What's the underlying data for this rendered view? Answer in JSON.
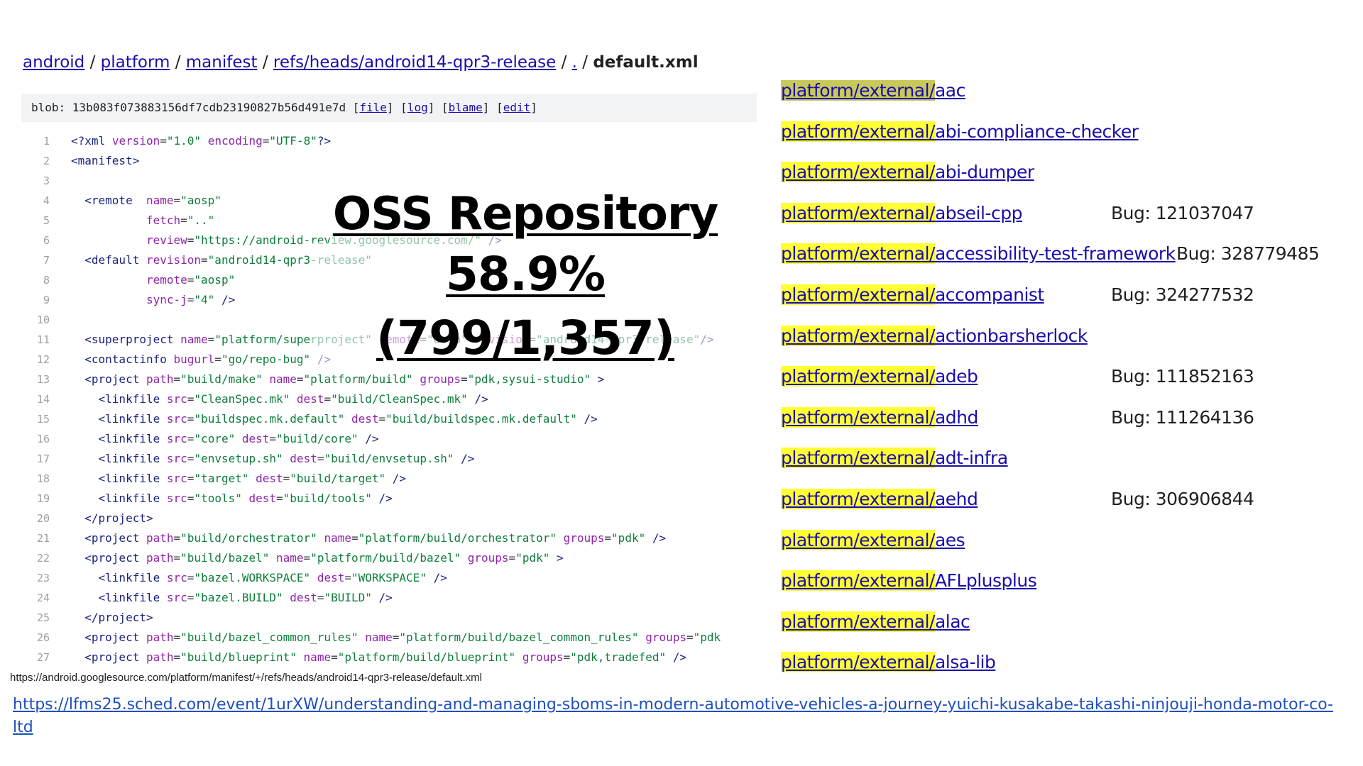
{
  "breadcrumb": {
    "items": [
      "android",
      "platform",
      "manifest",
      "refs/heads/android14-qpr3-release",
      "."
    ],
    "separator": "/",
    "current": "default.xml"
  },
  "blob": {
    "prefix": "blob: 13b083f073883156df7cdb23190827b56d491e7d",
    "links": [
      "file",
      "log",
      "blame",
      "edit"
    ]
  },
  "code_lines": [
    "<?xml version=\"1.0\" encoding=\"UTF-8\"?>",
    "<manifest>",
    "",
    "  <remote  name=\"aosp\"",
    "           fetch=\"..\"",
    "           review=\"https://android-review.googlesource.com/\" />",
    "  <default revision=\"android14-qpr3-release\"",
    "           remote=\"aosp\"",
    "           sync-j=\"4\" />",
    "",
    "  <superproject name=\"platform/superproject\" remote=\"aosp\" revision=\"android14-qpr3-release\"/>",
    "  <contactinfo bugurl=\"go/repo-bug\" />",
    "  <project path=\"build/make\" name=\"platform/build\" groups=\"pdk,sysui-studio\" >",
    "    <linkfile src=\"CleanSpec.mk\" dest=\"build/CleanSpec.mk\" />",
    "    <linkfile src=\"buildspec.mk.default\" dest=\"build/buildspec.mk.default\" />",
    "    <linkfile src=\"core\" dest=\"build/core\" />",
    "    <linkfile src=\"envsetup.sh\" dest=\"build/envsetup.sh\" />",
    "    <linkfile src=\"target\" dest=\"build/target\" />",
    "    <linkfile src=\"tools\" dest=\"build/tools\" />",
    "  </project>",
    "  <project path=\"build/orchestrator\" name=\"platform/build/orchestrator\" groups=\"pdk\" />",
    "  <project path=\"build/bazel\" name=\"platform/build/bazel\" groups=\"pdk\" >",
    "    <linkfile src=\"bazel.WORKSPACE\" dest=\"WORKSPACE\" />",
    "    <linkfile src=\"bazel.BUILD\" dest=\"BUILD\" />",
    "  </project>",
    "  <project path=\"build/bazel_common_rules\" name=\"platform/build/bazel_common_rules\" groups=\"pdk",
    "  <project path=\"build/blueprint\" name=\"platform/build/blueprint\" groups=\"pdk,tradefed\" />"
  ],
  "overlay": {
    "title": "OSS Repository",
    "stat": "58.9%(799/1,357)"
  },
  "status_url": "https://android.googlesource.com/platform/manifest/+/refs/heads/android14-qpr3-release/default.xml",
  "repos": [
    {
      "prefix": "platform/external/",
      "name": "aac",
      "bug": ""
    },
    {
      "prefix": "platform/external/",
      "name": "abi-compliance-checker",
      "bug": ""
    },
    {
      "prefix": "platform/external/",
      "name": "abi-dumper",
      "bug": ""
    },
    {
      "prefix": "platform/external/",
      "name": "abseil-cpp",
      "bug": "Bug: 121037047"
    },
    {
      "prefix": "platform/external/",
      "name": "accessibility-test-framework",
      "bug": "Bug: 328779485"
    },
    {
      "prefix": "platform/external/",
      "name": "accompanist",
      "bug": "Bug: 324277532"
    },
    {
      "prefix": "platform/external/",
      "name": "actionbarsherlock",
      "bug": ""
    },
    {
      "prefix": "platform/external/",
      "name": "adeb",
      "bug": "Bug: 111852163"
    },
    {
      "prefix": "platform/external/",
      "name": "adhd",
      "bug": "Bug: 111264136"
    },
    {
      "prefix": "platform/external/",
      "name": "adt-infra",
      "bug": ""
    },
    {
      "prefix": "platform/external/",
      "name": "aehd",
      "bug": "Bug: 306906844"
    },
    {
      "prefix": "platform/external/",
      "name": "aes",
      "bug": ""
    },
    {
      "prefix": "platform/external/",
      "name": "AFLplusplus",
      "bug": ""
    },
    {
      "prefix": "platform/external/",
      "name": "alac",
      "bug": ""
    },
    {
      "prefix": "platform/external/",
      "name": "alsa-lib",
      "bug": ""
    }
  ],
  "footer_link": "https://lfms25.sched.com/event/1urXW/understanding-and-managing-sboms-in-modern-automotive-vehicles-a-journey-yuichi-kusakabe-takashi-ninjouji-honda-motor-co-ltd"
}
